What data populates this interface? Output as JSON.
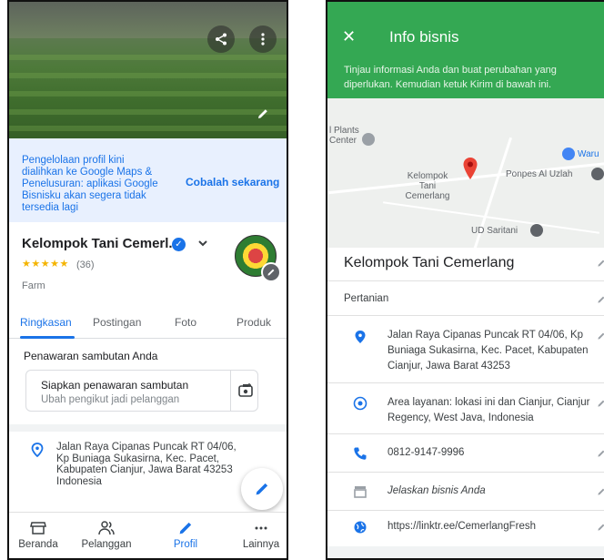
{
  "left": {
    "banner_text": "Pengelolaan profil kini dialihkan ke Google Maps & Penelusuran: aplikasi Google Bisnisku akan segera tidak tersedia lagi",
    "banner_cta": "Cobalah sekarang",
    "business_name": "Kelompok Tani Cemerl...",
    "stars": "★★★★★",
    "rating_count": "(36)",
    "category": "Farm",
    "tabs": [
      "Ringkasan",
      "Postingan",
      "Foto",
      "Produk"
    ],
    "welcome_section_title": "Penawaran sambutan Anda",
    "welcome_card_title": "Siapkan penawaran sambutan",
    "welcome_card_subtitle": "Ubah pengikut jadi pelanggan",
    "address": "Jalan Raya Cipanas Puncak RT 04/06, Kp Buniaga Sukasirna, Kec. Pacet, Kabupaten Cianjur, Jawa Barat 43253 Indonesia",
    "nav": [
      "Beranda",
      "Pelanggan",
      "Profil",
      "Lainnya"
    ],
    "colors": {
      "accent": "#1a73e8",
      "banner_bg": "#e8f0fe"
    }
  },
  "right": {
    "header_title": "Info bisnis",
    "header_subtitle": "Tinjau informasi Anda dan buat perubahan yang diperlukan. Kemudian ketuk Kirim di bawah ini.",
    "map_labels": {
      "plants_center": "l Plants Center",
      "warung": "Waru",
      "business_pin": "Kelompok Tani Cemerlang",
      "ponpes": "Ponpes Al Uzlah",
      "ud_saritani": "UD Saritani"
    },
    "business_name": "Kelompok Tani Cemerlang",
    "category": "Pertanian",
    "address": "Jalan Raya Cipanas Puncak RT 04/06, Kp Buniaga Sukasirna, Kec. Pacet, Kabupaten Cianjur, Jawa Barat 43253",
    "service_area": "Area layanan: lokasi ini dan Cianjur, Cianjur Regency, West Java, Indonesia",
    "phone": "0812-9147-9996",
    "description": "Jelaskan bisnis Anda",
    "website": "https://linktr.ee/CemerlangFresh",
    "colors": {
      "header_bg": "#34a853",
      "icon": "#1a73e8"
    }
  }
}
